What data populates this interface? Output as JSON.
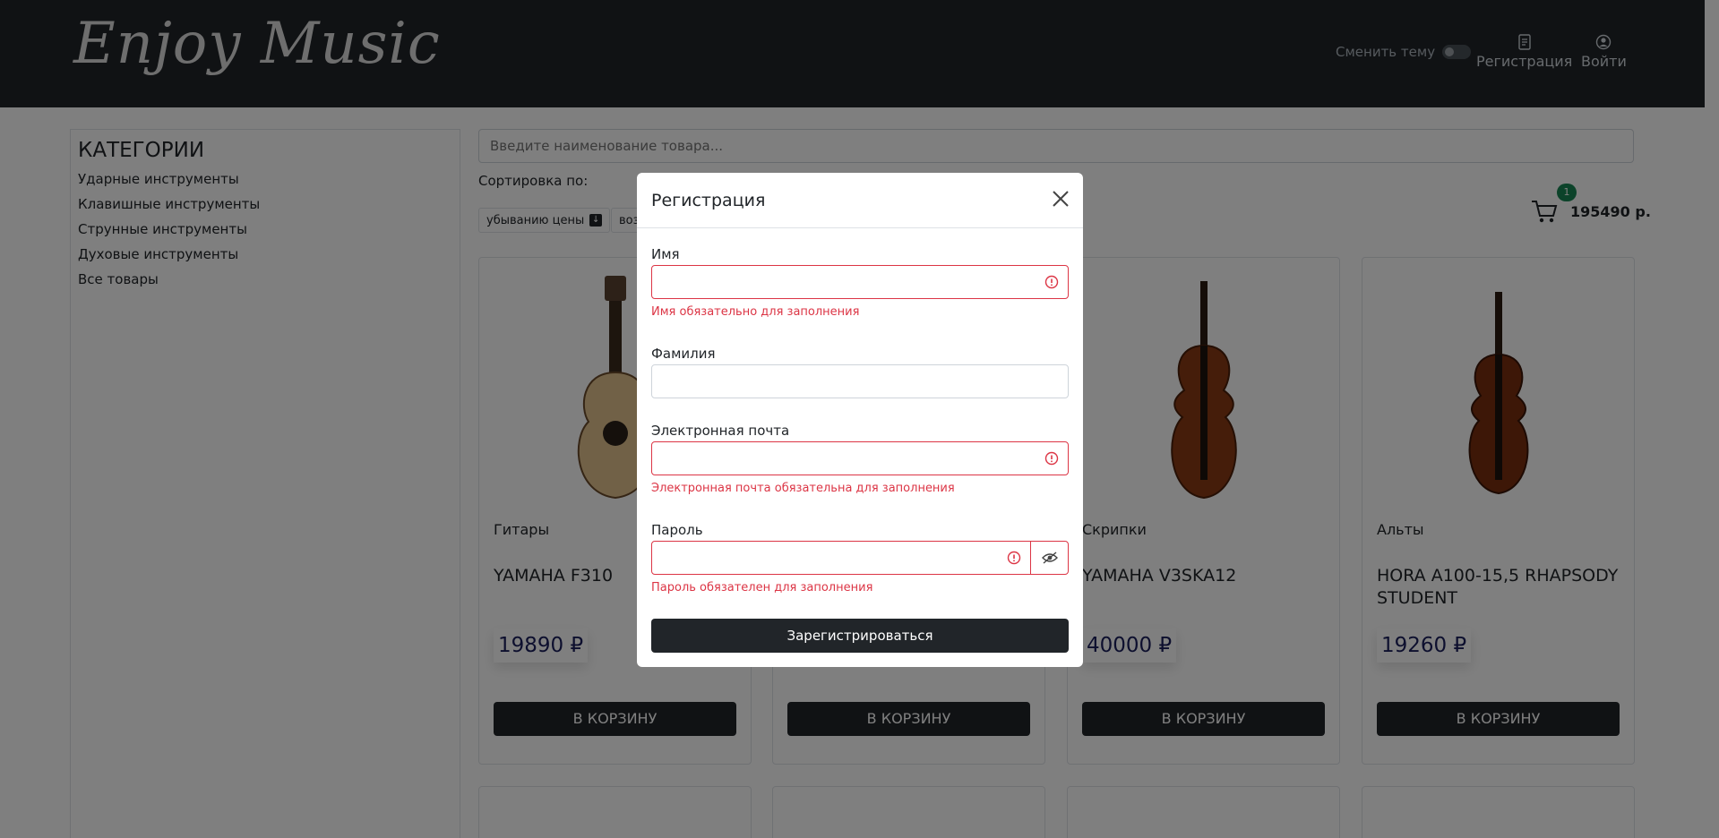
{
  "header": {
    "logo": "Enjoy Music",
    "theme_label": "Сменить тему",
    "register_label": "Регистрация",
    "login_label": "Войти"
  },
  "sidebar": {
    "title": "КАТЕГОРИИ",
    "items": [
      {
        "label": "Ударные инструменты"
      },
      {
        "label": "Клавишные инструменты"
      },
      {
        "label": "Струнные инструменты"
      },
      {
        "label": "Духовые инструменты"
      },
      {
        "label": "Все товары"
      }
    ]
  },
  "search": {
    "placeholder": "Введите наименование товара..."
  },
  "sort": {
    "label": "Сортировка по:",
    "buttons": [
      {
        "label": "убыванию цены"
      },
      {
        "label": "воз"
      }
    ]
  },
  "cart": {
    "count": "1",
    "total": "195490 р."
  },
  "products": [
    {
      "type": "Гитары",
      "name": "YAMAHA F310",
      "price": "19890 ₽",
      "buy_label": "В КОРЗИНУ",
      "image": "acoustic-guitar"
    },
    {
      "type": "",
      "name": "",
      "price": "",
      "buy_label": "В КОРЗИНУ",
      "image": "instrument"
    },
    {
      "type": "Скрипки",
      "name": "YAMAHA V3SKA12",
      "price": "40000 ₽",
      "buy_label": "В КОРЗИНУ",
      "image": "violin"
    },
    {
      "type": "Альты",
      "name": "HORA A100-15,5 RHAPSODY STUDENT",
      "price": "19260 ₽",
      "buy_label": "В КОРЗИНУ",
      "image": "viola"
    }
  ],
  "modal": {
    "title": "Регистрация",
    "fields": {
      "first_name": {
        "label": "Имя",
        "value": "",
        "error": "Имя обязательно для заполнения"
      },
      "last_name": {
        "label": "Фамилия",
        "value": ""
      },
      "email": {
        "label": "Электронная почта",
        "value": "",
        "error": "Электронная почта обязательна для заполнения"
      },
      "password": {
        "label": "Пароль",
        "value": "",
        "error": "Пароль обязателен для заполнения"
      }
    },
    "submit_label": "Зарегистрироваться"
  },
  "colors": {
    "header_bg": "#212529",
    "error": "#dc3545",
    "badge": "#198754",
    "price": "#1a1f5c"
  }
}
